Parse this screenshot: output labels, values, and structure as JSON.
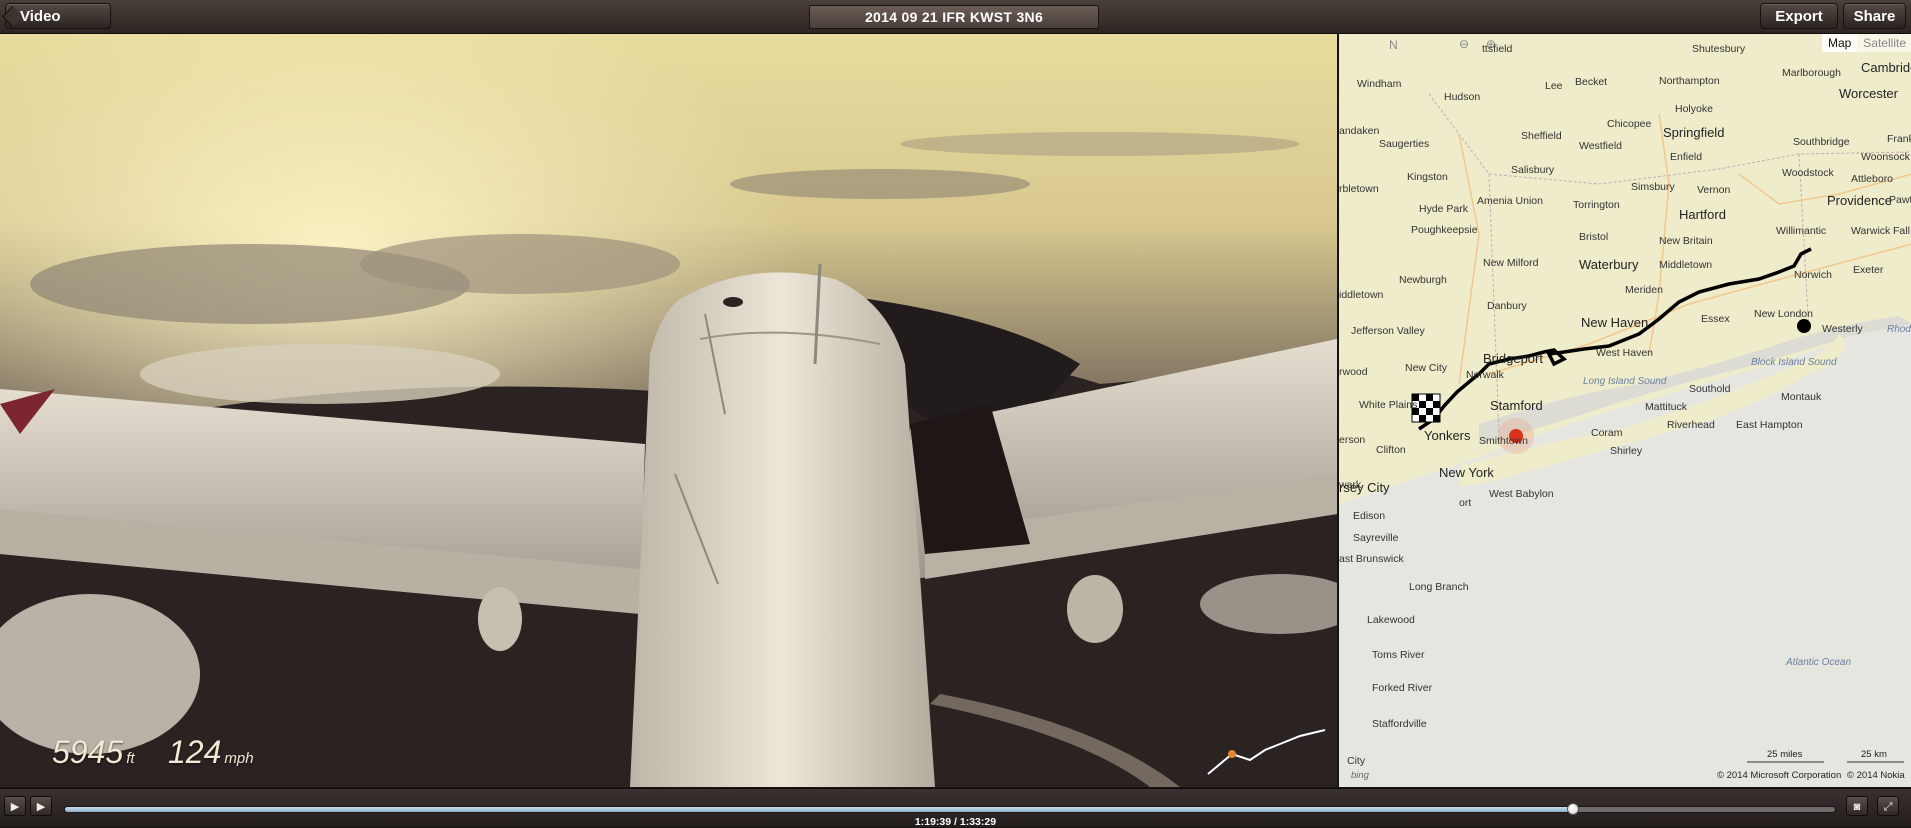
{
  "toolbar": {
    "back_label": "Video Gallery",
    "title": "2014 09 21 IFR KWST 3N6",
    "export_label": "Export",
    "share_label": "Share"
  },
  "overlay": {
    "altitude_value": "5945",
    "altitude_unit": "ft",
    "speed_value": "124",
    "speed_unit": "mph",
    "track_marker_color": "#e2872c"
  },
  "map": {
    "tabs": {
      "map": "Map",
      "satellite": "Satellite"
    },
    "compass_label": "N",
    "labels": [
      "ttsfield",
      "Shutesbury",
      "Cambridge",
      "Windham",
      "Hudson",
      "Lee",
      "Becket",
      "Northampton",
      "Marlborough",
      "Worcester",
      "andaken",
      "Holyoke",
      "Saugerties",
      "Sheffield",
      "Chicopee",
      "Springfield",
      "Westfield",
      "Southbridge",
      "Frank",
      "Woonsock",
      "Enfield",
      "Salisbury",
      "Kingston",
      "Woodstock",
      "Attleboro",
      "rbletown",
      "Amenia Union",
      "Simsbury",
      "Vernon",
      "Torrington",
      "Providence",
      "Pawtu",
      "Hyde Park",
      "Hartford",
      "Poughkeepsie",
      "Bristol",
      "New Britain",
      "Willimantic",
      "Warwick",
      "Fall Rive",
      "Norwich",
      "Waterbury",
      "Middletown",
      "New Milford",
      "Exeter",
      "Newburgh",
      "Meriden",
      "iddletown",
      "Danbury",
      "Essex",
      "New London",
      "Westerly",
      "Rhode",
      "Jefferson Valley",
      "New Haven",
      "Bridgeport",
      "West Haven",
      "rwood",
      "New City",
      "Norwalk",
      "Long Island Sound",
      "Block Island Sound",
      "Southold",
      "Montauk",
      "White Plains",
      "Stamford",
      "Mattituck",
      "erson",
      "Yonkers",
      "Riverhead",
      "East Hampton",
      "Clifton",
      "Coram",
      "Shirley",
      "New York",
      "wark",
      "rsey City",
      "West Babylon",
      "Edison",
      "Sayreville",
      "ast Brunswick",
      "Long Branch",
      "Lakewood",
      "Toms River",
      "Forked River",
      "Atlantic Ocean",
      "Staffordville",
      "City",
      "ort",
      "Smithtown"
    ],
    "scale_miles": "25 miles",
    "scale_km": "25 km",
    "copyright_ms": "© 2014 Microsoft Corporation",
    "copyright_nokia": "© 2014 Nokia",
    "bing_label": "bing",
    "route_color": "#000000",
    "current_position_color": "#d9331f"
  },
  "playback": {
    "current_time": "1:19:39",
    "total_time": "1:33:29",
    "time_display": "1:19:39 / 1:33:29",
    "progress": 0.852,
    "accent": "#8fb0cf"
  }
}
